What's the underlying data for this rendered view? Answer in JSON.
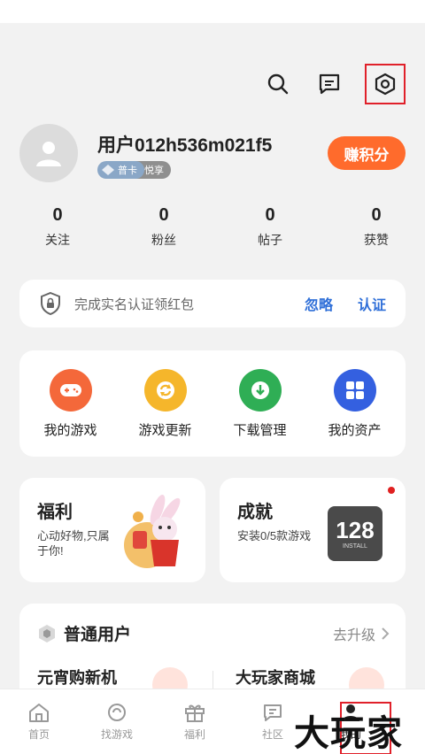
{
  "header": {
    "icons": [
      "search-icon",
      "message-icon",
      "settings-icon"
    ]
  },
  "profile": {
    "username": "用户012h536m021f5",
    "badges": [
      {
        "icon": "hexagon-level-icon",
        "label": ""
      },
      {
        "icon": "card-icon",
        "label": "普卡"
      },
      {
        "icon": "vip-icon",
        "label": "悦享"
      }
    ],
    "earn_points_label": "赚积分"
  },
  "stats": [
    {
      "value": "0",
      "label": "关注"
    },
    {
      "value": "0",
      "label": "粉丝"
    },
    {
      "value": "0",
      "label": "帖子"
    },
    {
      "value": "0",
      "label": "获赞"
    }
  ],
  "verify": {
    "text": "完成实名认证领红包",
    "ignore_label": "忽略",
    "verify_label": "认证"
  },
  "quick_actions": [
    {
      "label": "我的游戏",
      "icon": "gamepad-icon",
      "color": "#f4683a"
    },
    {
      "label": "游戏更新",
      "icon": "refresh-icon",
      "color": "#f5b62b"
    },
    {
      "label": "下载管理",
      "icon": "download-icon",
      "color": "#2fae55"
    },
    {
      "label": "我的资产",
      "icon": "grid-icon",
      "color": "#3460e0"
    }
  ],
  "promos": {
    "welfare": {
      "title": "福利",
      "subtitle": "心动好物,只属于你!"
    },
    "achievement": {
      "title": "成就",
      "subtitle": "安装0/5款游戏",
      "badge_text": "128",
      "badge_subtext": "INSTALL"
    }
  },
  "membership": {
    "title": "普通用户",
    "upgrade_label": "去升级",
    "items": [
      "元宵购新机",
      "大玩家商城"
    ]
  },
  "tabbar": [
    {
      "label": "首页",
      "icon": "home-icon"
    },
    {
      "label": "找游戏",
      "icon": "find-game-icon"
    },
    {
      "label": "福利",
      "icon": "gift-icon"
    },
    {
      "label": "社区",
      "icon": "community-icon"
    },
    {
      "label": "我的",
      "icon": "profile-icon"
    }
  ],
  "watermark": "大玩家",
  "colors": {
    "accent_orange": "#ff6b2c",
    "link_blue": "#2f6fd8",
    "highlight_red": "#e0202a"
  }
}
